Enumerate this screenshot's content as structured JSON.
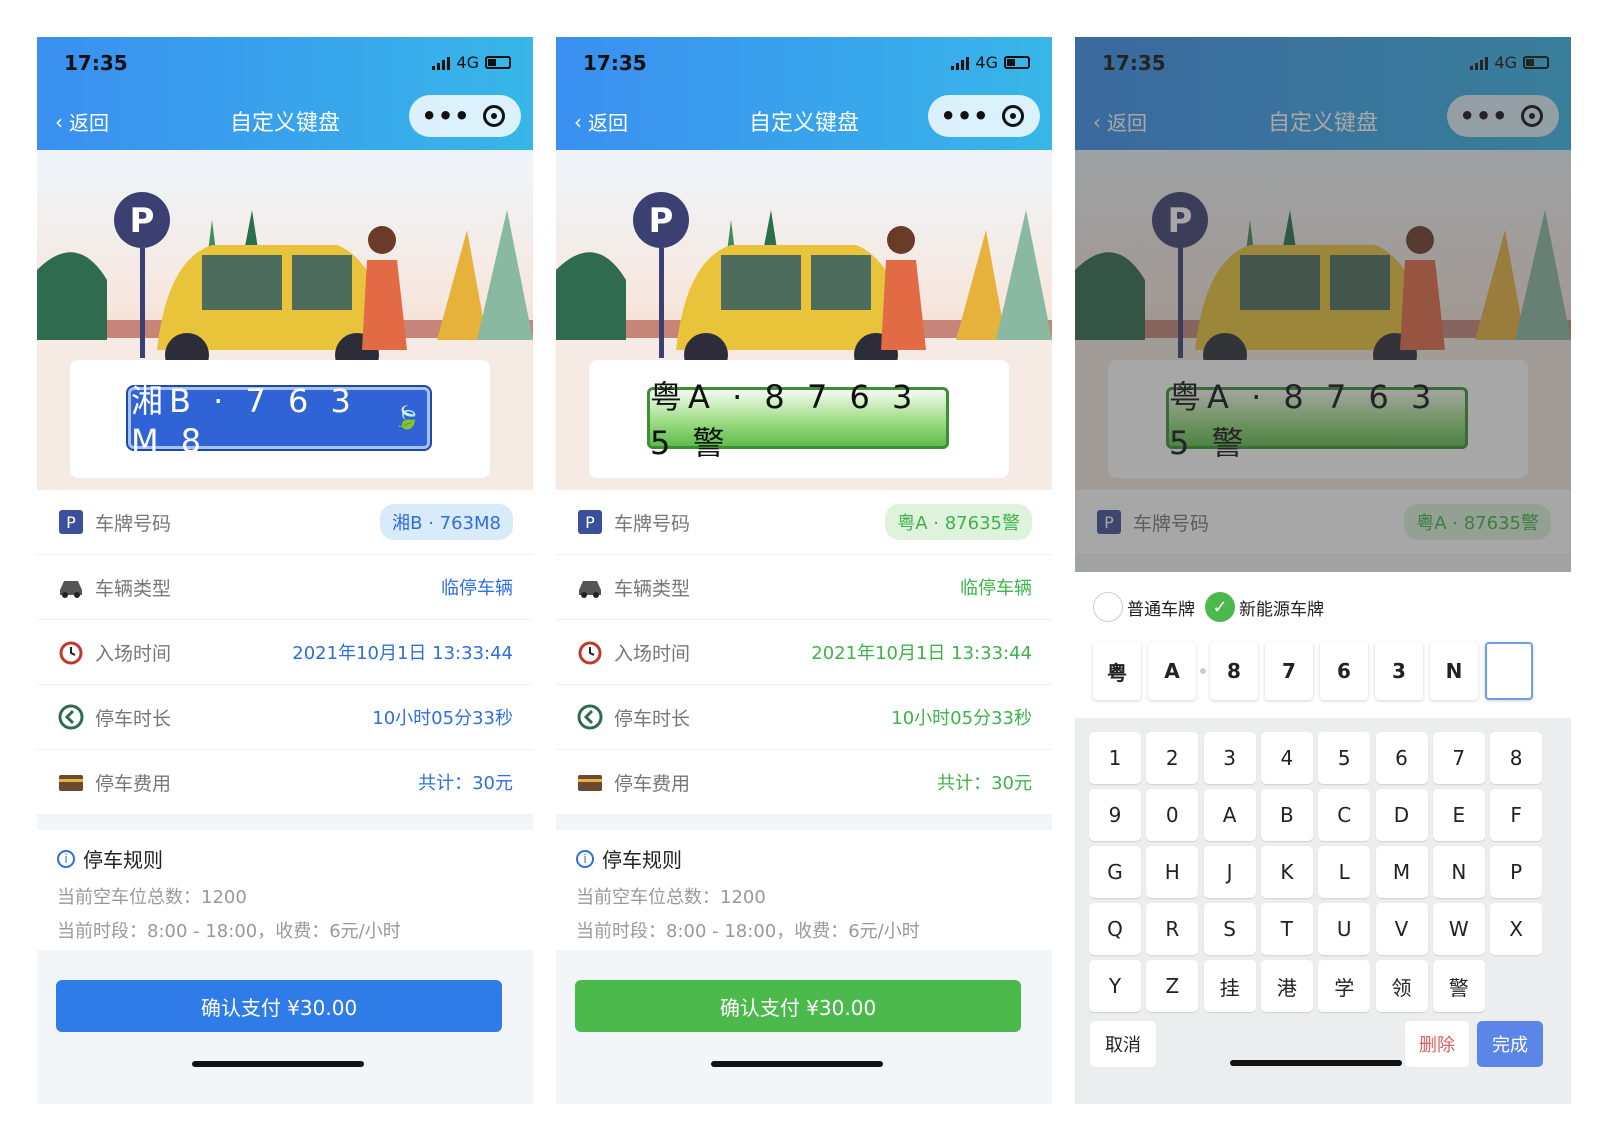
{
  "status": {
    "time": "17:35",
    "network": "4G"
  },
  "nav": {
    "back": "返回",
    "title": "自定义键盘",
    "more": "•••"
  },
  "screens": [
    {
      "plate": "湘B · 7 6 3 M 8",
      "rows": [
        {
          "label": "车牌号码",
          "value": "湘B · 763M8"
        },
        {
          "label": "车辆类型",
          "value": "临停车辆"
        },
        {
          "label": "入场时间",
          "value": "2021年10月1日 13:33:44"
        },
        {
          "label": "停车时长",
          "value": "10小时05分33秒"
        },
        {
          "label": "停车费用",
          "value": "共计：30元"
        }
      ],
      "rules_title": "停车规则",
      "rules_line1": "当前空车位总数：1200",
      "rules_line2": "当前时段：8:00 - 18:00，收费：6元/小时",
      "pay": "确认支付 ¥30.00",
      "accent": "#2f7ce8"
    },
    {
      "plate": "粤A · 8 7 6 3 5 警",
      "rows": [
        {
          "label": "车牌号码",
          "value": "粤A · 87635警"
        },
        {
          "label": "车辆类型",
          "value": "临停车辆"
        },
        {
          "label": "入场时间",
          "value": "2021年10月1日 13:33:44"
        },
        {
          "label": "停车时长",
          "value": "10小时05分33秒"
        },
        {
          "label": "停车费用",
          "value": "共计：30元"
        }
      ],
      "rules_title": "停车规则",
      "rules_line1": "当前空车位总数：1200",
      "rules_line2": "当前时段：8:00 - 18:00，收费：6元/小时",
      "pay": "确认支付 ¥30.00",
      "accent": "#4cb94d"
    },
    {
      "plate": "粤A · 8 7 6 3 5 警",
      "rows": [
        {
          "label": "车牌号码",
          "value": "粤A · 87635警"
        }
      ],
      "radio_normal": "普通车牌",
      "radio_new_energy": "新能源车牌",
      "slots": [
        "粤",
        "A",
        "8",
        "7",
        "6",
        "3",
        "N",
        ""
      ],
      "keys": [
        [
          "1",
          "2",
          "3",
          "4",
          "5",
          "6",
          "7",
          "8"
        ],
        [
          "9",
          "0",
          "A",
          "B",
          "C",
          "D",
          "E",
          "F"
        ],
        [
          "G",
          "H",
          "J",
          "K",
          "L",
          "M",
          "N",
          "P"
        ],
        [
          "Q",
          "R",
          "S",
          "T",
          "U",
          "V",
          "W",
          "X"
        ],
        [
          "Y",
          "Z",
          "挂",
          "港",
          "学",
          "领",
          "警"
        ]
      ],
      "cancel": "取消",
      "delete": "删除",
      "done": "完成",
      "accent": "#4cb94d"
    }
  ],
  "icons": [
    "back-chevron-icon",
    "more-dots-icon",
    "capsule-close-icon",
    "parking-p-icon",
    "car-icon",
    "alarm-clock-icon",
    "duration-icon",
    "wallet-icon",
    "info-icon",
    "leaf-icon",
    "check-icon"
  ]
}
